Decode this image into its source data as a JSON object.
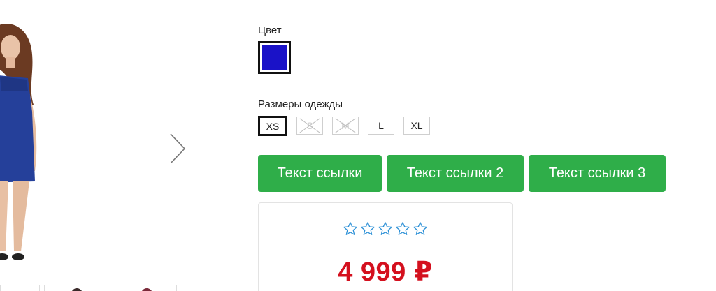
{
  "gallery": {
    "next_icon": "chevron-right-icon"
  },
  "options": {
    "color_label": "Цвет",
    "selected_color": "#1a12c8",
    "size_label": "Размеры одежды",
    "sizes": [
      {
        "label": "XS",
        "state": "selected"
      },
      {
        "label": "S",
        "state": "disabled"
      },
      {
        "label": "M",
        "state": "disabled"
      },
      {
        "label": "L",
        "state": "available"
      },
      {
        "label": "XL",
        "state": "available"
      }
    ]
  },
  "actions": {
    "link1": "Текст ссылки",
    "link2": "Текст ссылки 2",
    "link3": "Текст ссылки 3",
    "button_color": "#2fae49"
  },
  "price_card": {
    "rating": 0,
    "rating_max": 5,
    "star_icon": "star-outline-icon",
    "price": "4 999 ₽",
    "price_color": "#d4101e"
  }
}
